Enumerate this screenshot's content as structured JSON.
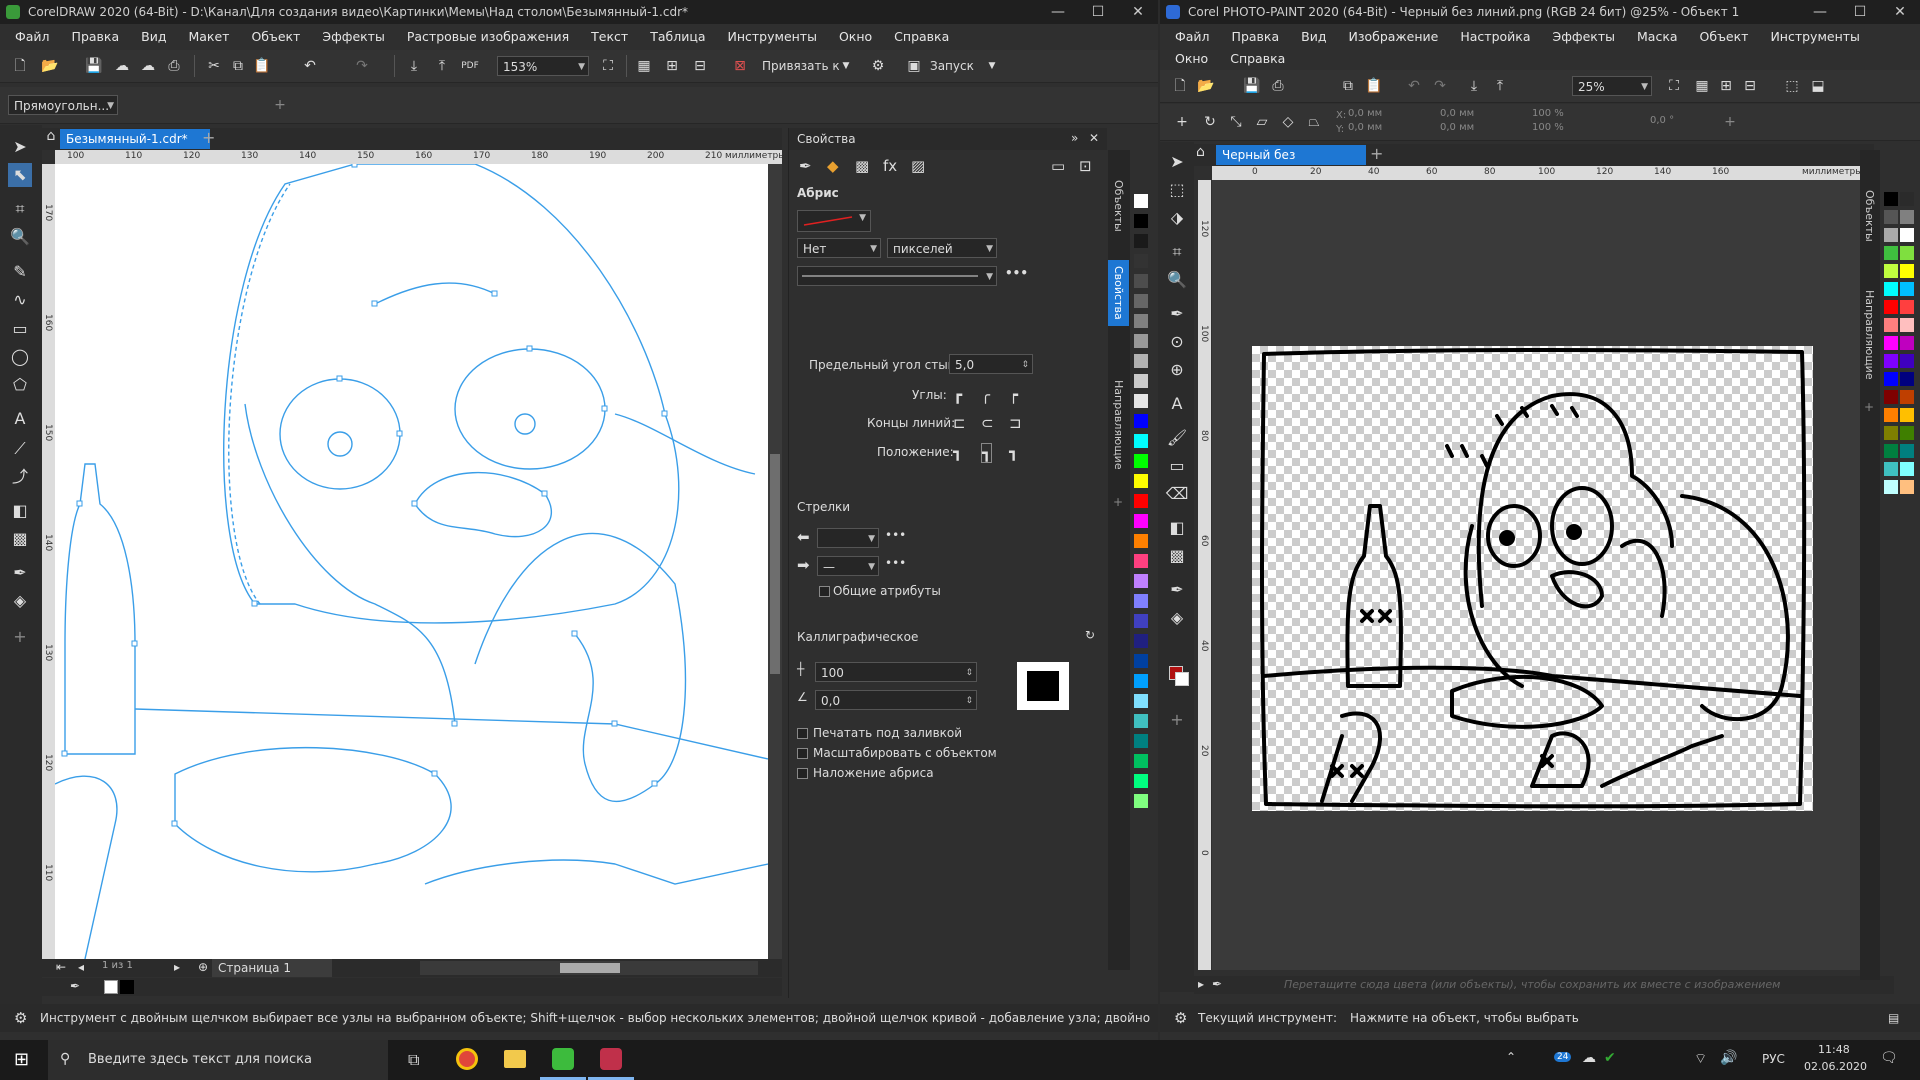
{
  "cdr": {
    "title": "CorelDRAW 2020 (64-Bit) - D:\\Канал\\Для создания видео\\Картинки\\Мемы\\Над столом\\Безымянный-1.cdr*",
    "menu": [
      "Файл",
      "Правка",
      "Вид",
      "Макет",
      "Объект",
      "Эффекты",
      "Растровые изображения",
      "Текст",
      "Таблица",
      "Инструменты",
      "Окно",
      "Справка"
    ],
    "zoom": "153%",
    "snap_label": "Привязать к",
    "launch_label": "Запуск",
    "shape_select": "Прямоугольн...",
    "doc_tab": "Безымянный-1.cdr*",
    "ruler_ticks": [
      "100",
      "110",
      "120",
      "130",
      "140",
      "150",
      "160",
      "170",
      "180",
      "190",
      "200",
      "210"
    ],
    "ruler_unit": "миллиметры",
    "vruler_ticks": [
      "170",
      "160",
      "150",
      "140",
      "130",
      "120",
      "110"
    ],
    "page_nav": "1 из 1",
    "page_tab": "Страница 1",
    "status": "Инструмент с двойным щелчком выбирает все узлы на выбранном объекте; Shift+щелчок - выбор нескольких элементов; двойной щелчок кривой - добавление узла; двойной щелчок узла - его уда"
  },
  "props": {
    "title": "Свойства",
    "outline_header": "Абрис",
    "width_value": "Нет",
    "units_value": "пикселей",
    "miter_label": "Предельный угол стыка:",
    "miter_value": "5,0",
    "corners_label": "Углы:",
    "linecaps_label": "Концы линий:",
    "position_label": "Положение:",
    "arrows_header": "Стрелки",
    "shared_attrs": "Общие атрибуты",
    "calligraphic_header": "Каллиграфическое",
    "stretch_value": "100",
    "angle_value": "0,0",
    "print_under_fill": "Печатать под заливкой",
    "scale_with_object": "Масштабировать с объектом",
    "overprint_outline": "Наложение абриса",
    "side_tab_objects": "Объекты",
    "side_tab_props": "Свойства",
    "side_tab_guides": "Направляющие"
  },
  "pp": {
    "title": "Corel PHOTO-PAINT 2020 (64-Bit) - Черный без линий.png (RGB 24 бит) @25% - Объект 1",
    "menu": [
      "Файл",
      "Правка",
      "Вид",
      "Изображение",
      "Настройка",
      "Эффекты",
      "Маска",
      "Объект",
      "Инструменты",
      "Окно",
      "Справка"
    ],
    "zoom": "25%",
    "x_value": "0,0 мм",
    "y_value": "0,0 мм",
    "w_value": "0,0 мм",
    "h_value": "0,0 мм",
    "sx_value": "100 %",
    "sy_value": "100 %",
    "angle_value": "0,0 °",
    "doc_tab": "Черный без линий.p...",
    "ruler_ticks": [
      "0",
      "20",
      "40",
      "60",
      "80",
      "100",
      "120",
      "140",
      "160"
    ],
    "ruler_unit": "миллиметры",
    "vruler_ticks": [
      "120",
      "100",
      "80",
      "60",
      "40",
      "20",
      "0"
    ],
    "palette_hint": "Перетащите сюда цвета (или объекты), чтобы сохранить их вместе с изображением",
    "status_tool": "Текущий инструмент:",
    "status_hint": "Нажмите на объект, чтобы выбрать",
    "side_tab_objects": "Объекты",
    "side_tab_guides": "Направляющие"
  },
  "taskbar": {
    "search_placeholder": "Введите здесь текст для поиска",
    "lang": "РУС",
    "time": "11:48",
    "date": "02.06.2020",
    "notif_badge": "24"
  },
  "colors": {
    "accent_blue": "#2e8ae6",
    "wire_blue": "#3a9ee8",
    "outline_red": "#e02020",
    "palette_cdr": [
      "#ffffff",
      "#000000",
      "#1a1a1a",
      "#333333",
      "#4d4d4d",
      "#666666",
      "#808080",
      "#999999",
      "#b3b3b3",
      "#cccccc",
      "#e6e6e6",
      "#0000ff",
      "#00ffff",
      "#00ff00",
      "#ffff00",
      "#ff0000",
      "#ff00ff",
      "#ff8000",
      "#ff4080",
      "#c080ff",
      "#8080ff",
      "#4040c0",
      "#202080",
      "#0040a0",
      "#00a0ff",
      "#80e0ff",
      "#40c0c0",
      "#008080",
      "#00c060",
      "#00ff80",
      "#80ff80"
    ],
    "palette_pp": [
      "#000000",
      "#2b2b2b",
      "#555555",
      "#808080",
      "#aaaaaa",
      "#ffffff",
      "#3fbf3f",
      "#7fdf3f",
      "#bfff3f",
      "#ffff00",
      "#00ffff",
      "#00bfff",
      "#ff0000",
      "#ff3f3f",
      "#ff7f7f",
      "#ffbfbf",
      "#ff00ff",
      "#bf00bf",
      "#7f00ff",
      "#3f00bf",
      "#0000ff",
      "#00007f",
      "#7f0000",
      "#bf3f00",
      "#ff7f00",
      "#ffbf00",
      "#7f7f00",
      "#3f7f00",
      "#007f3f",
      "#007f7f",
      "#3fbfbf",
      "#7fffff",
      "#bfffff",
      "#ffbf7f"
    ]
  }
}
